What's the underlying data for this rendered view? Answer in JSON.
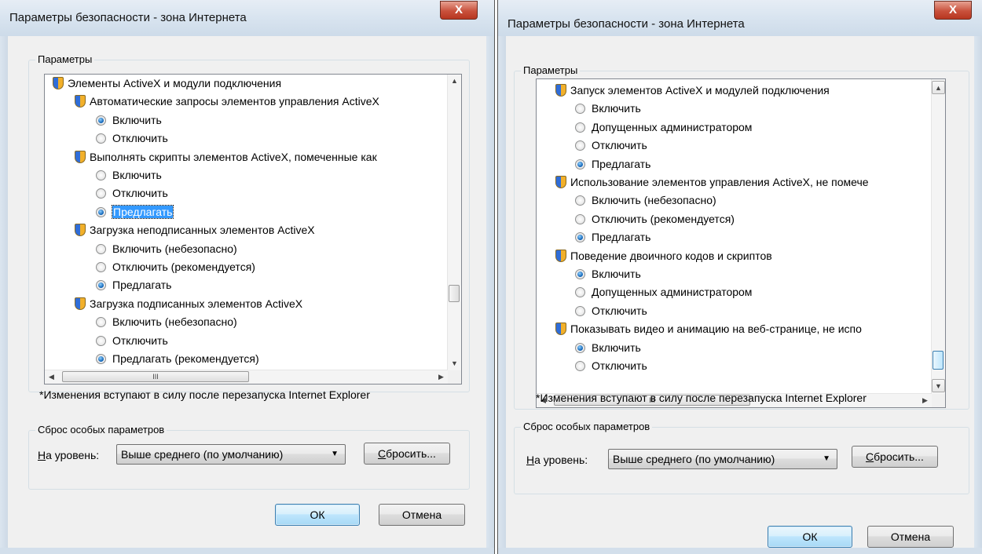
{
  "left": {
    "title": "Параметры безопасности - зона Интернета",
    "close_label": "X",
    "group_label": "Параметры",
    "rows": [
      {
        "kind": "cat",
        "text": "Элементы ActiveX и модули подключения"
      },
      {
        "kind": "set",
        "text": "Автоматические запросы элементов управления ActiveX"
      },
      {
        "kind": "opt",
        "text": "Включить",
        "checked": true
      },
      {
        "kind": "opt",
        "text": "Отключить",
        "checked": false
      },
      {
        "kind": "set",
        "text": "Выполнять скрипты элементов ActiveX, помеченные как"
      },
      {
        "kind": "opt",
        "text": "Включить",
        "checked": false
      },
      {
        "kind": "opt",
        "text": "Отключить",
        "checked": false
      },
      {
        "kind": "opt",
        "text": "Предлагать",
        "checked": true,
        "selected": true
      },
      {
        "kind": "set",
        "text": "Загрузка неподписанных элементов ActiveX"
      },
      {
        "kind": "opt",
        "text": "Включить (небезопасно)",
        "checked": false
      },
      {
        "kind": "opt",
        "text": "Отключить (рекомендуется)",
        "checked": false
      },
      {
        "kind": "opt",
        "text": "Предлагать",
        "checked": true
      },
      {
        "kind": "set",
        "text": "Загрузка подписанных элементов ActiveX"
      },
      {
        "kind": "opt",
        "text": "Включить (небезопасно)",
        "checked": false
      },
      {
        "kind": "opt",
        "text": "Отключить",
        "checked": false
      },
      {
        "kind": "opt",
        "text": "Предлагать (рекомендуется)",
        "checked": true
      }
    ],
    "note": "*Изменения вступают в силу после перезапуска Internet Explorer",
    "reset_group_label": "Сброс особых параметров",
    "level_label_first": "Н",
    "level_label_rest": "а уровень:",
    "level_value": "Выше среднего (по умолчанию)",
    "reset_button_first": "С",
    "reset_button_rest": "бросить...",
    "ok_label": "ОК",
    "cancel_label": "Отмена",
    "vscroll_position": 0.72
  },
  "right": {
    "title": "Параметры безопасности - зона Интернета",
    "close_label": "X",
    "group_label": "Параметры",
    "rows": [
      {
        "kind": "set",
        "text": "Запуск элементов ActiveX и модулей подключения"
      },
      {
        "kind": "opt",
        "text": "Включить",
        "checked": false
      },
      {
        "kind": "opt",
        "text": "Допущенных администратором",
        "checked": false
      },
      {
        "kind": "opt",
        "text": "Отключить",
        "checked": false
      },
      {
        "kind": "opt",
        "text": "Предлагать",
        "checked": true
      },
      {
        "kind": "set",
        "text": "Использование элементов управления ActiveX, не помече"
      },
      {
        "kind": "opt",
        "text": "Включить (небезопасно)",
        "checked": false
      },
      {
        "kind": "opt",
        "text": "Отключить (рекомендуется)",
        "checked": false
      },
      {
        "kind": "opt",
        "text": "Предлагать",
        "checked": true
      },
      {
        "kind": "set",
        "text": "Поведение двоичного кодов и скриптов"
      },
      {
        "kind": "opt",
        "text": "Включить",
        "checked": true
      },
      {
        "kind": "opt",
        "text": "Допущенных администратором",
        "checked": false
      },
      {
        "kind": "opt",
        "text": "Отключить",
        "checked": false
      },
      {
        "kind": "set",
        "text": "Показывать видео и анимацию на веб-странице, не испо"
      },
      {
        "kind": "opt",
        "text": "Включить",
        "checked": true
      },
      {
        "kind": "opt",
        "text": "Отключить",
        "checked": false
      }
    ],
    "note": "*Изменения вступают в силу после перезапуска Internet Explorer",
    "reset_group_label": "Сброс особых параметров",
    "level_label_first": "Н",
    "level_label_rest": "а уровень:",
    "level_value": "Выше среднего (по умолчанию)",
    "reset_button_first": "С",
    "reset_button_rest": "бросить...",
    "ok_label": "ОК",
    "cancel_label": "Отмена",
    "vscroll_position": 0.86
  },
  "icons": {
    "close": "close-icon",
    "security_setting": "security-shield-icon",
    "scroll_up": "▲",
    "scroll_down": "▼",
    "scroll_left": "◀",
    "scroll_right": "▶",
    "hgrip": "III",
    "combo_arrow": "▼"
  }
}
